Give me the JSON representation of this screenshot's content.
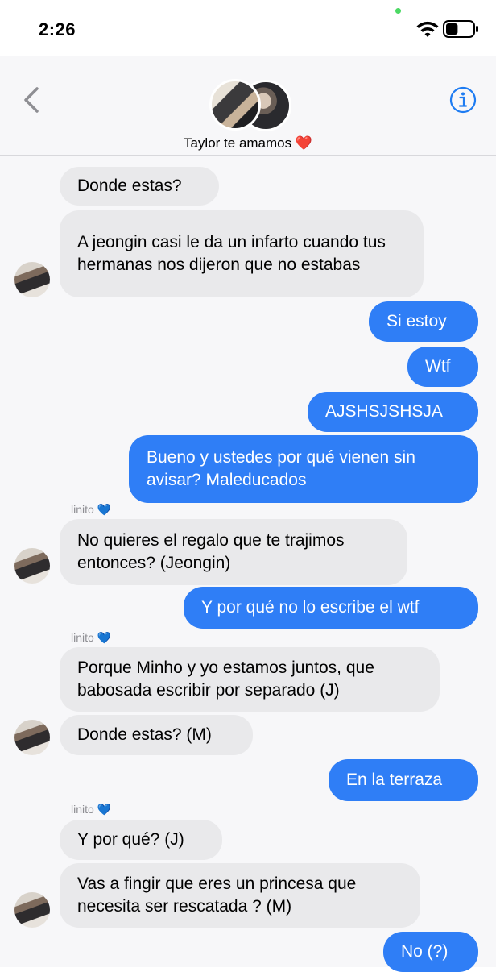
{
  "status_bar": {
    "time": "2:26",
    "battery_level": 0.45
  },
  "header": {
    "back_icon": "chevron-left-icon",
    "title": "Taylor te amamos ❤️",
    "info_icon": "info-icon"
  },
  "messages": [
    {
      "direction": "in",
      "text": "Donde estas?"
    },
    {
      "direction": "in",
      "text": "A jeongin casi le da un infarto cuando tus hermanas nos dijeron que no estabas"
    },
    {
      "direction": "out",
      "text": "Si estoy"
    },
    {
      "direction": "out",
      "text": "Wtf"
    },
    {
      "direction": "out",
      "text": "AJSHSJSHSJA"
    },
    {
      "direction": "out",
      "text": "Bueno y ustedes por qué vienen sin avisar? Maleducados"
    },
    {
      "direction": "in",
      "sender": "linito 💙",
      "text": "No quieres el regalo que te trajimos entonces? (Jeongin)"
    },
    {
      "direction": "out",
      "text": "Y por qué no lo escribe el wtf"
    },
    {
      "direction": "in",
      "sender": "linito 💙",
      "text": "Porque Minho y yo estamos juntos, que babosada escribir por separado (J)"
    },
    {
      "direction": "in",
      "text": "Donde estas? (M)"
    },
    {
      "direction": "out",
      "text": "En la terraza"
    },
    {
      "direction": "in",
      "sender": "linito 💙",
      "text": "Y por qué? (J)"
    },
    {
      "direction": "in",
      "text": "Vas a fingir que eres un princesa que necesita ser rescatada ? (M)"
    },
    {
      "direction": "out",
      "text": "No (?)"
    }
  ],
  "colors": {
    "outgoing": "#2f7ef6",
    "incoming": "#e9e9eb",
    "accent": "#1e7cf2"
  }
}
